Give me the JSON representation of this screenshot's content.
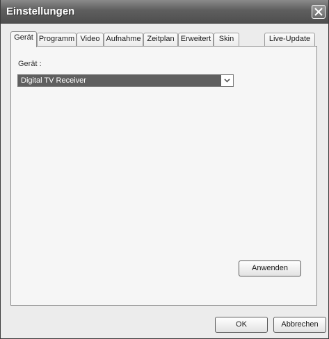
{
  "window": {
    "title": "Einstellungen"
  },
  "tabs": [
    {
      "label": "Gerät",
      "active": true
    },
    {
      "label": "Programm",
      "active": false
    },
    {
      "label": "Video",
      "active": false
    },
    {
      "label": "Aufnahme",
      "active": false
    },
    {
      "label": "Zeitplan",
      "active": false
    },
    {
      "label": "Erweitert",
      "active": false
    },
    {
      "label": "Skin",
      "active": false
    },
    {
      "label": "Live-Update",
      "active": false
    }
  ],
  "device": {
    "label": "Gerät :",
    "selected_value": "Digital TV Receiver"
  },
  "buttons": {
    "apply": "Anwenden",
    "ok": "OK",
    "cancel": "Abbrechen"
  },
  "icons": {
    "close": "close-icon",
    "dropdown": "chevron-down-icon"
  }
}
